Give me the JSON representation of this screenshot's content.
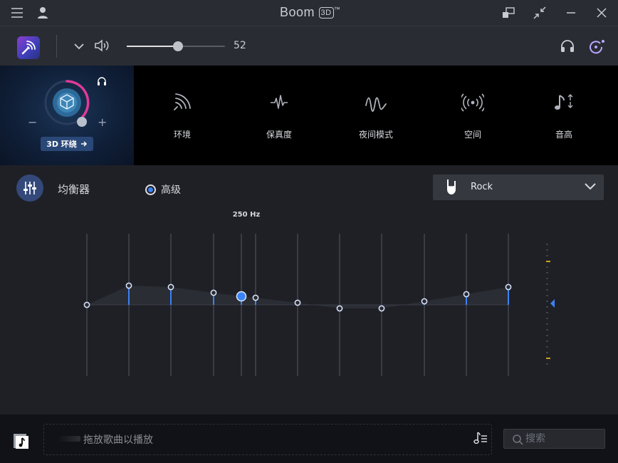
{
  "app": {
    "title_pre": "Boom",
    "title_box": "3D",
    "title_tm": "™"
  },
  "volume": {
    "value": "52",
    "level_percent": 52
  },
  "surround": {
    "button_label": "3D 环绕",
    "minus": "−",
    "plus": "+"
  },
  "effects": [
    {
      "id": "ambience",
      "label": "环境",
      "icon": "wifi-signal-icon"
    },
    {
      "id": "fidelity",
      "label": "保真度",
      "icon": "waveform-icon"
    },
    {
      "id": "night",
      "label": "夜间模式",
      "icon": "wave-icon"
    },
    {
      "id": "spatial",
      "label": "空间",
      "icon": "broadcast-icon"
    },
    {
      "id": "pitch",
      "label": "音高",
      "icon": "music-note-icon"
    }
  ],
  "equalizer": {
    "title": "均衡器",
    "mode_label": "高级",
    "preset": "Rock",
    "active_band": "250 Hz",
    "band_levels": [
      0,
      0.27,
      0.25,
      0.17,
      0.12,
      0.1,
      0.03,
      -0.05,
      -0.05,
      0.05,
      0.15,
      0.25
    ],
    "active_index": 4
  },
  "bottom": {
    "drop_text": "拖放歌曲以播放",
    "search_placeholder": "搜索"
  },
  "colors": {
    "accent": "#3b82f6",
    "dial_arc": "#e0399a",
    "eq_btn": "#34497a",
    "preset_bg": "#363840"
  }
}
